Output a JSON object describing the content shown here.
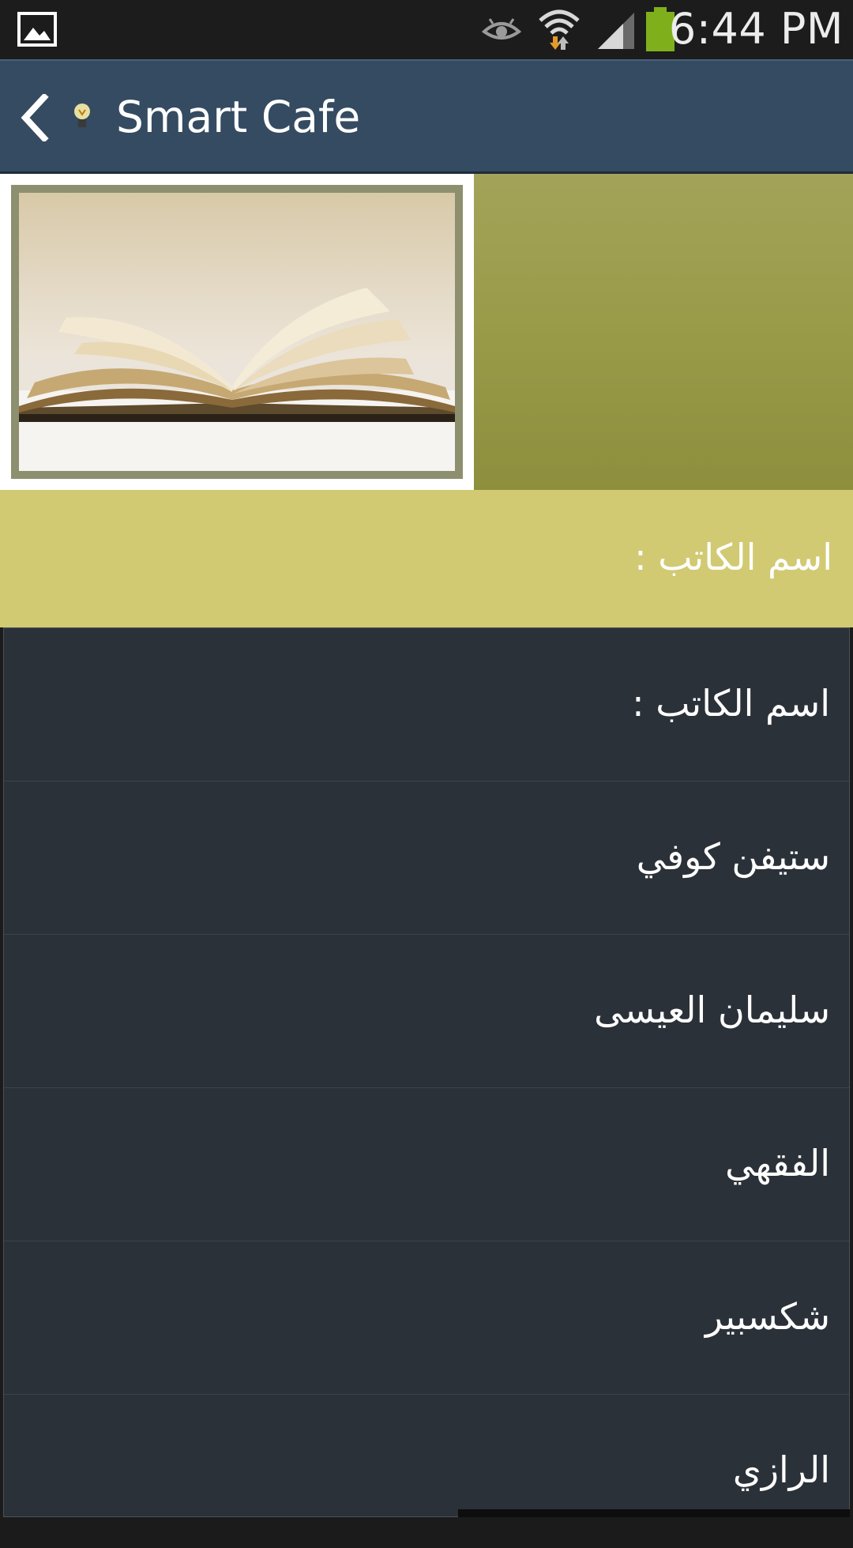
{
  "status_bar": {
    "time": "6:44 PM",
    "icons": [
      "image-notification-icon",
      "eye-icon",
      "wifi-icon",
      "signal-icon",
      "battery-icon"
    ]
  },
  "action_bar": {
    "title": "Smart Cafe",
    "back_icon": "chevron-left-icon",
    "app_icon": "lightbulb-icon",
    "background": "#344b62"
  },
  "banner": {
    "image": "open-book-image",
    "background": "#9a9c4a"
  },
  "spinner": {
    "selected_label": "اسم الكاتب :",
    "background": "#d1ca73"
  },
  "dropdown": {
    "items": [
      {
        "label": "اسم الكاتب :"
      },
      {
        "label": "ستيفن كوفي"
      },
      {
        "label": "سليمان العيسى"
      },
      {
        "label": "الفقهي"
      },
      {
        "label": "شكسبير"
      },
      {
        "label": "الرازي"
      }
    ],
    "background": "#2b3138"
  }
}
